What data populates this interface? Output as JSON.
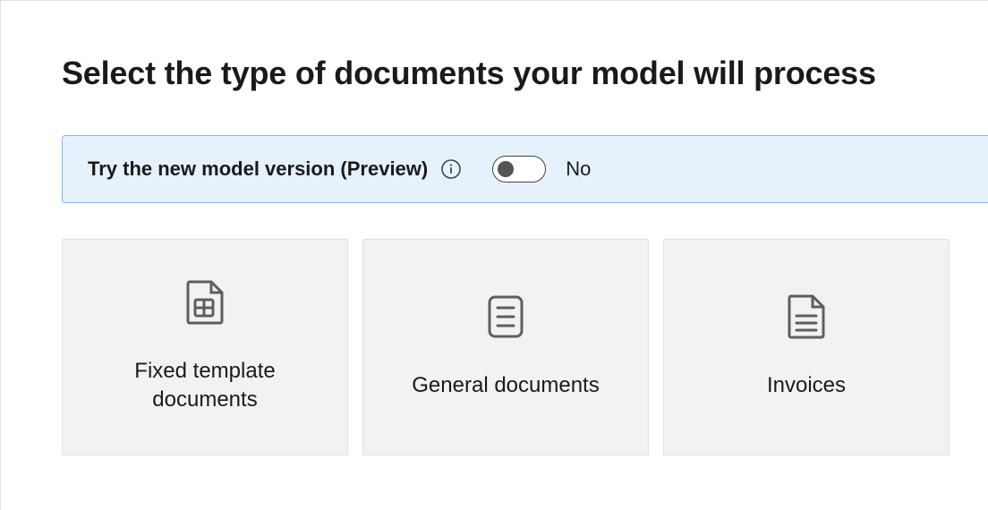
{
  "page": {
    "title": "Select the type of documents your model will process"
  },
  "previewBanner": {
    "label": "Try the new model version (Preview)",
    "toggleState": "No"
  },
  "cards": [
    {
      "title": "Fixed template documents",
      "icon": "fixed-template-document-icon"
    },
    {
      "title": "General documents",
      "icon": "general-document-icon"
    },
    {
      "title": "Invoices",
      "icon": "invoice-document-icon"
    }
  ]
}
